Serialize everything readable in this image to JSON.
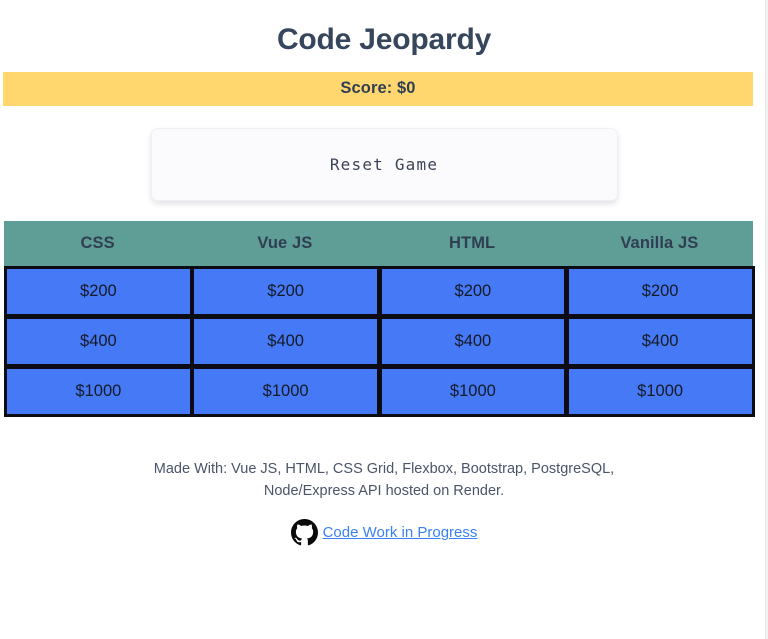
{
  "header": {
    "title": "Code Jeopardy",
    "score_label": "Score: $0"
  },
  "controls": {
    "reset_label": "Reset Game"
  },
  "board": {
    "categories": [
      "CSS",
      "Vue JS",
      "HTML",
      "Vanilla JS"
    ],
    "rows": [
      [
        "$200",
        "$200",
        "$200",
        "$200"
      ],
      [
        "$400",
        "$400",
        "$400",
        "$400"
      ],
      [
        "$1000",
        "$1000",
        "$1000",
        "$1000"
      ]
    ]
  },
  "footer": {
    "made_with": "Made With: Vue JS, HTML, CSS Grid, Flexbox, Bootstrap, PostgreSQL, Node/Express API hosted on Render.",
    "repo_link_label": "Code Work in Progress",
    "repo_icon": "github-icon"
  },
  "colors": {
    "score_bar": "#ffd76e",
    "category_header": "#5f9e96",
    "tile": "#4579f5",
    "tile_border": "#0c0c12",
    "title_text": "#36465d",
    "link": "#3b82f6",
    "background": "#ffffff"
  }
}
